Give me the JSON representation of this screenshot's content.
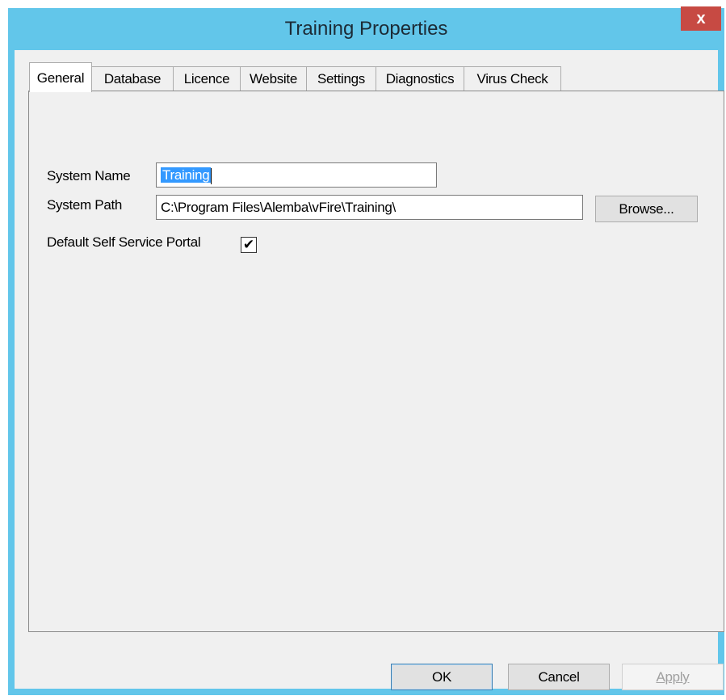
{
  "window": {
    "title": "Training Properties",
    "close_label": "x"
  },
  "tabs": [
    {
      "label": "General"
    },
    {
      "label": "Database"
    },
    {
      "label": "Licence"
    },
    {
      "label": "Website"
    },
    {
      "label": "Settings"
    },
    {
      "label": "Diagnostics"
    },
    {
      "label": "Virus Check"
    }
  ],
  "general": {
    "system_name_label": "System Name",
    "system_name_value": "Training",
    "system_path_label": "System Path",
    "system_path_value": "C:\\Program Files\\Alemba\\vFire\\Training\\",
    "browse_label": "Browse...",
    "default_portal_label": "Default Self Service Portal",
    "default_portal_checked": true,
    "checkmark": "✔"
  },
  "buttons": {
    "ok": "OK",
    "cancel": "Cancel",
    "apply": "Apply"
  }
}
